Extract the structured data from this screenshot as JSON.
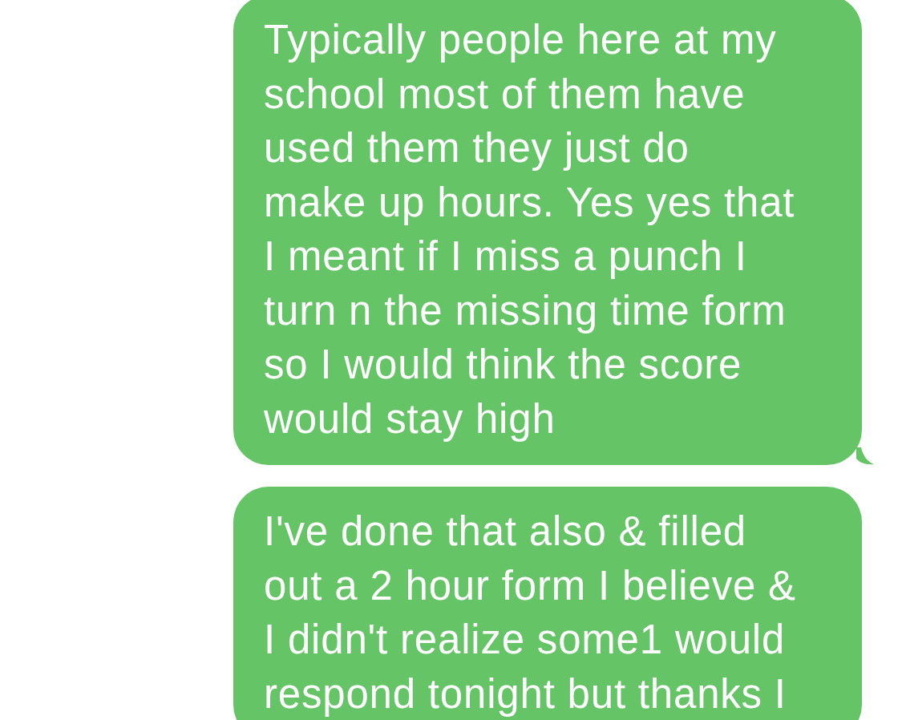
{
  "messages": [
    {
      "kind": "sent",
      "tail": true,
      "text": "Typically people here at my\nschool most of them have\nused them they just do\nmake up hours. Yes yes that\nI meant if I miss a punch I\nturn n the missing time form\nso I would think the score\nwould stay high"
    },
    {
      "kind": "sent",
      "text": "I've done that also & filled\nout a 2 hour form I believe &\nI didn't realize some1 would\nrespond tonight but thanks I"
    }
  ]
}
